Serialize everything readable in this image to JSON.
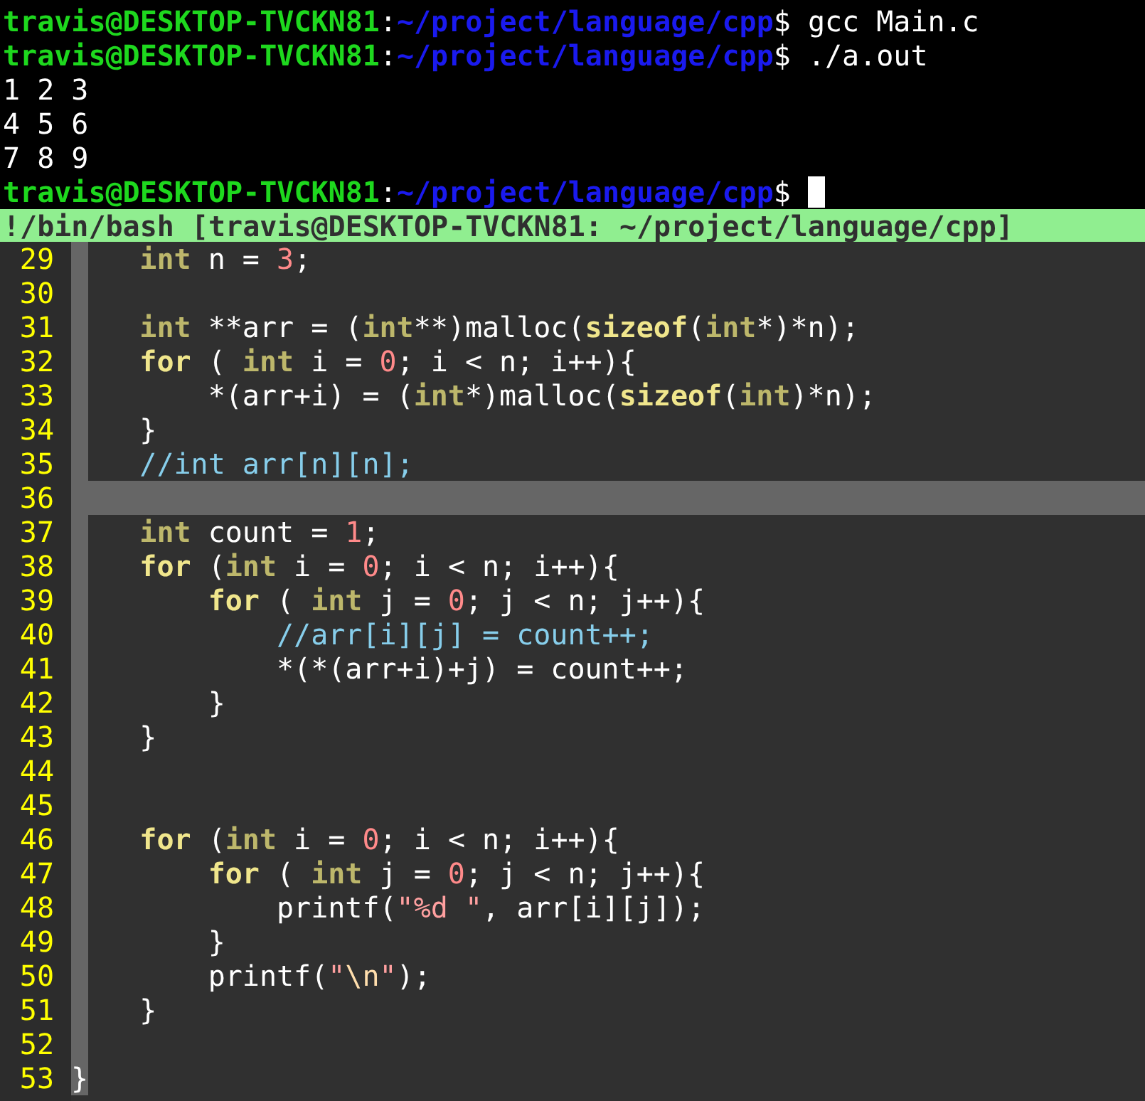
{
  "terminal": {
    "lines": [
      {
        "kind": "prompt",
        "user": "travis@DESKTOP-TVCKN81",
        "separator": ":",
        "path": "~/project/language/cpp",
        "command": "$ gcc Main.c",
        "cursor": false
      },
      {
        "kind": "prompt",
        "user": "travis@DESKTOP-TVCKN81",
        "separator": ":",
        "path": "~/project/language/cpp",
        "command": "$ ./a.out",
        "cursor": false
      },
      {
        "kind": "output",
        "text": "1 2 3"
      },
      {
        "kind": "output",
        "text": "4 5 6"
      },
      {
        "kind": "output",
        "text": "7 8 9"
      },
      {
        "kind": "prompt",
        "user": "travis@DESKTOP-TVCKN81",
        "separator": ":",
        "path": "~/project/language/cpp",
        "command": "$",
        "cursor": true
      }
    ]
  },
  "status_bar": {
    "text": "!/bin/bash [travis@DESKTOP-TVCKN81: ~/project/language/cpp]"
  },
  "editor": {
    "lines": [
      {
        "number": "29",
        "selected": false,
        "tokens": [
          {
            "kind": "type",
            "text": "    int"
          },
          {
            "kind": "plain",
            "text": " n = "
          },
          {
            "kind": "number",
            "text": "3"
          },
          {
            "kind": "plain",
            "text": ";"
          }
        ]
      },
      {
        "number": "30",
        "selected": false
      },
      {
        "number": "31",
        "selected": false,
        "tokens": [
          {
            "kind": "type",
            "text": "    int"
          },
          {
            "kind": "plain",
            "text": " **arr = ("
          },
          {
            "kind": "type",
            "text": "int"
          },
          {
            "kind": "plain",
            "text": "**)malloc("
          },
          {
            "kind": "keyword",
            "text": "sizeof"
          },
          {
            "kind": "plain",
            "text": "("
          },
          {
            "kind": "type",
            "text": "int"
          },
          {
            "kind": "plain",
            "text": "*)*n);"
          }
        ]
      },
      {
        "number": "32",
        "selected": false,
        "tokens": [
          {
            "kind": "keyword",
            "text": "    for"
          },
          {
            "kind": "plain",
            "text": " ( "
          },
          {
            "kind": "type",
            "text": "int"
          },
          {
            "kind": "plain",
            "text": " i = "
          },
          {
            "kind": "number",
            "text": "0"
          },
          {
            "kind": "plain",
            "text": "; i < n; i++){"
          }
        ]
      },
      {
        "number": "33",
        "selected": false,
        "tokens": [
          {
            "kind": "plain",
            "text": "        *(arr+i) = ("
          },
          {
            "kind": "type",
            "text": "int"
          },
          {
            "kind": "plain",
            "text": "*)malloc("
          },
          {
            "kind": "keyword",
            "text": "sizeof"
          },
          {
            "kind": "plain",
            "text": "("
          },
          {
            "kind": "type",
            "text": "int"
          },
          {
            "kind": "plain",
            "text": ")*n);"
          }
        ]
      },
      {
        "number": "34",
        "selected": false,
        "tokens": [
          {
            "kind": "plain",
            "text": "    }"
          }
        ]
      },
      {
        "number": "35",
        "selected": false,
        "tokens": [
          {
            "kind": "comment",
            "text": "    //int arr[n][n];"
          }
        ]
      },
      {
        "number": "36",
        "selected": true
      },
      {
        "number": "37",
        "selected": false,
        "tokens": [
          {
            "kind": "type",
            "text": "    int"
          },
          {
            "kind": "plain",
            "text": " count = "
          },
          {
            "kind": "number",
            "text": "1"
          },
          {
            "kind": "plain",
            "text": ";"
          }
        ]
      },
      {
        "number": "38",
        "selected": false,
        "tokens": [
          {
            "kind": "keyword",
            "text": "    for"
          },
          {
            "kind": "plain",
            "text": " ("
          },
          {
            "kind": "type",
            "text": "int"
          },
          {
            "kind": "plain",
            "text": " i = "
          },
          {
            "kind": "number",
            "text": "0"
          },
          {
            "kind": "plain",
            "text": "; i < n; i++){"
          }
        ]
      },
      {
        "number": "39",
        "selected": false,
        "tokens": [
          {
            "kind": "keyword",
            "text": "        for"
          },
          {
            "kind": "plain",
            "text": " ( "
          },
          {
            "kind": "type",
            "text": "int"
          },
          {
            "kind": "plain",
            "text": " j = "
          },
          {
            "kind": "number",
            "text": "0"
          },
          {
            "kind": "plain",
            "text": "; j < n; j++){"
          }
        ]
      },
      {
        "number": "40",
        "selected": false,
        "tokens": [
          {
            "kind": "comment",
            "text": "            //arr[i][j] = count++;"
          }
        ]
      },
      {
        "number": "41",
        "selected": false,
        "tokens": [
          {
            "kind": "plain",
            "text": "            *(*(arr+i)+j) = count++;"
          }
        ]
      },
      {
        "number": "42",
        "selected": false,
        "tokens": [
          {
            "kind": "plain",
            "text": "        }"
          }
        ]
      },
      {
        "number": "43",
        "selected": false,
        "tokens": [
          {
            "kind": "plain",
            "text": "    }"
          }
        ]
      },
      {
        "number": "44",
        "selected": false
      },
      {
        "number": "45",
        "selected": false
      },
      {
        "number": "46",
        "selected": false,
        "tokens": [
          {
            "kind": "keyword",
            "text": "    for"
          },
          {
            "kind": "plain",
            "text": " ("
          },
          {
            "kind": "type",
            "text": "int"
          },
          {
            "kind": "plain",
            "text": " i = "
          },
          {
            "kind": "number",
            "text": "0"
          },
          {
            "kind": "plain",
            "text": "; i < n; i++){"
          }
        ]
      },
      {
        "number": "47",
        "selected": false,
        "tokens": [
          {
            "kind": "keyword",
            "text": "        for"
          },
          {
            "kind": "plain",
            "text": " ( "
          },
          {
            "kind": "type",
            "text": "int"
          },
          {
            "kind": "plain",
            "text": " j = "
          },
          {
            "kind": "number",
            "text": "0"
          },
          {
            "kind": "plain",
            "text": "; j < n; j++){"
          }
        ]
      },
      {
        "number": "48",
        "selected": false,
        "tokens": [
          {
            "kind": "plain",
            "text": "            printf("
          },
          {
            "kind": "string",
            "text": "\"%d \""
          },
          {
            "kind": "plain",
            "text": ", arr[i][j]);"
          }
        ]
      },
      {
        "number": "49",
        "selected": false,
        "tokens": [
          {
            "kind": "plain",
            "text": "        }"
          }
        ]
      },
      {
        "number": "50",
        "selected": false,
        "tokens": [
          {
            "kind": "plain",
            "text": "        printf("
          },
          {
            "kind": "string",
            "text": "\""
          },
          {
            "kind": "special",
            "text": "\\n"
          },
          {
            "kind": "string",
            "text": "\""
          },
          {
            "kind": "plain",
            "text": ");"
          }
        ]
      },
      {
        "number": "51",
        "selected": false,
        "tokens": [
          {
            "kind": "plain",
            "text": "    }"
          }
        ]
      },
      {
        "number": "52",
        "selected": false
      },
      {
        "number": "53",
        "selected": false,
        "tokens": [
          {
            "kind": "plain",
            "text": "}"
          }
        ]
      }
    ]
  }
}
